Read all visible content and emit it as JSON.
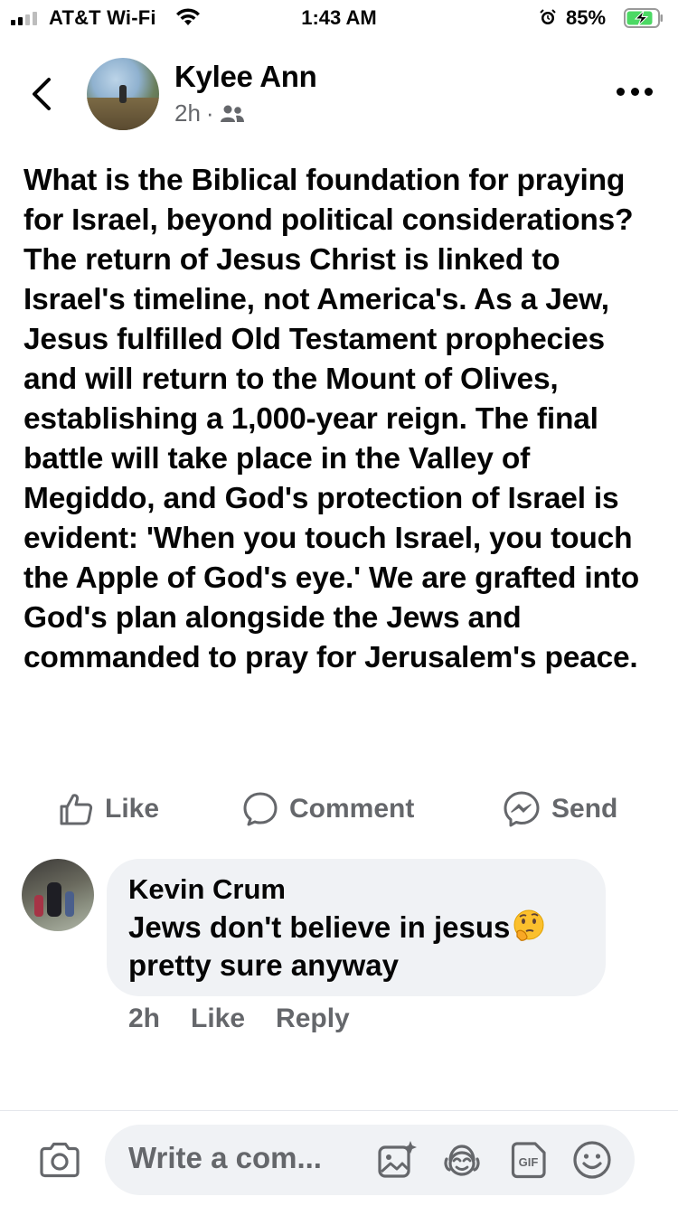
{
  "status_bar": {
    "carrier": "AT&T Wi-Fi",
    "time": "1:43 AM",
    "battery_percent": "85%",
    "signal_bars_filled": 2,
    "signal_bars_total": 4
  },
  "header": {
    "back_icon": "chevron-left-icon",
    "author_name": "Kylee Ann",
    "post_age": "2h",
    "separator": "·",
    "audience_icon": "friends-icon",
    "more_icon": "more-horizontal-icon"
  },
  "post": {
    "text": "What is the Biblical foundation for praying for Israel, beyond political considerations? The return of Jesus Christ is linked to Israel's timeline, not America's. As a Jew, Jesus fulfilled Old Testament prophecies and will return to the Mount of Olives, establishing a 1,000-year reign. The final battle will take place in the Valley of Megiddo, and God's protection of Israel is evident: 'When you touch Israel, you touch the Apple of God's eye.' We are grafted into God's plan alongside the Jews and commanded to pray for Jerusalem's peace."
  },
  "actions": {
    "like_label": "Like",
    "comment_label": "Comment",
    "send_label": "Send"
  },
  "comment": {
    "author": "Kevin Crum",
    "text": "Jews don't believe in jesus",
    "emoji": "thinking-face-icon",
    "text_line2": "pretty sure anyway",
    "age": "2h",
    "like_label": "Like",
    "reply_label": "Reply"
  },
  "composer": {
    "placeholder": "Write a com...",
    "icons": [
      "camera-icon",
      "photo-sparkle-icon",
      "avatar-sticker-icon",
      "gif-icon",
      "smiley-icon"
    ]
  },
  "colors": {
    "text": "#050505",
    "secondary_text": "#65676b",
    "bubble_bg": "#f0f2f5",
    "battery_charging": "#4cd964"
  }
}
